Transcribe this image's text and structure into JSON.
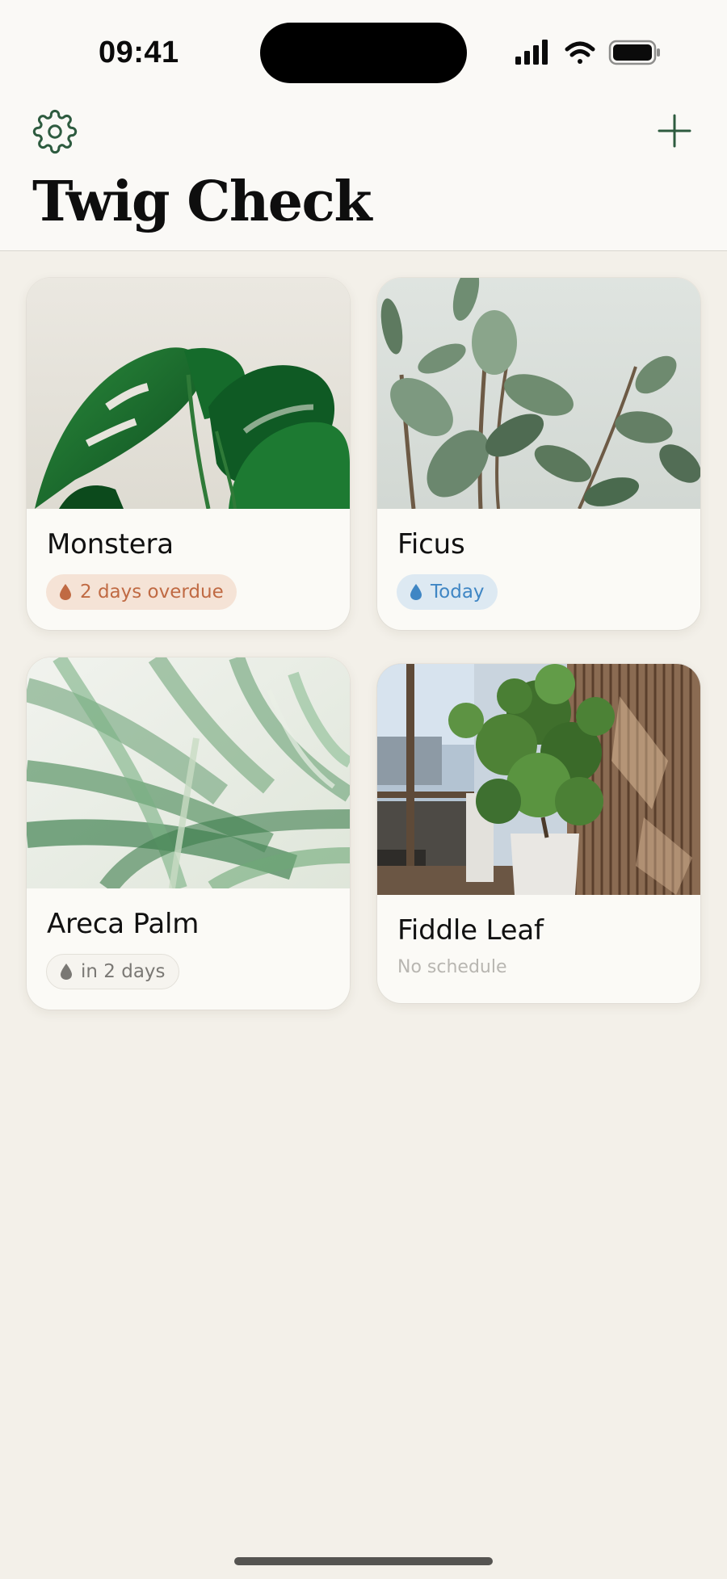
{
  "status_bar": {
    "time": "09:41",
    "icons": [
      "signal-icon",
      "wifi-icon",
      "battery-icon"
    ]
  },
  "header": {
    "title": "Twig Check",
    "settings_icon": "gear-icon",
    "add_icon": "plus-icon"
  },
  "colors": {
    "accent": "#2d5b3f",
    "overdue": "#c06a43",
    "today": "#3f86c4",
    "later": "#7a7874",
    "background": "#f3f0e9"
  },
  "plants": [
    {
      "name": "Monstera",
      "status": "2 days overdue",
      "status_type": "overdue"
    },
    {
      "name": "Ficus",
      "status": "Today",
      "status_type": "today"
    },
    {
      "name": "Areca Palm",
      "status": "in 2 days",
      "status_type": "later"
    },
    {
      "name": "Fiddle Leaf",
      "status": "No schedule",
      "status_type": "none"
    }
  ]
}
